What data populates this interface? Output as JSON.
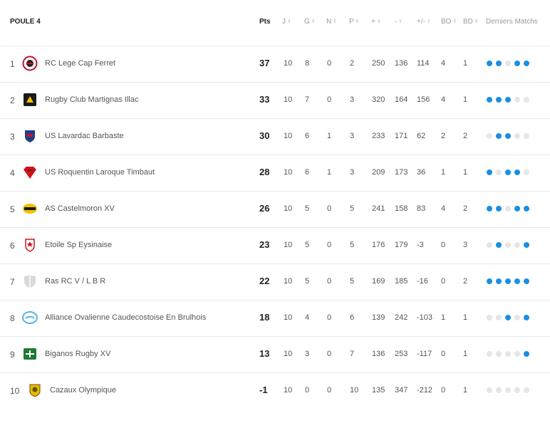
{
  "header": {
    "title": "POULE 4",
    "columns": {
      "pts": "Pts",
      "j": "J",
      "g": "G",
      "n": "N",
      "p": "P",
      "plus": "+",
      "minus": "-",
      "diff": "+/-",
      "bo": "BO",
      "bd": "BD",
      "last": "Derniers Matchs"
    }
  },
  "rows": [
    {
      "rank": "1",
      "team": "RC Lege Cap Ferret",
      "logo_icon": "lege-cap-ferret-logo-icon",
      "logo_color": "#c8102e",
      "pts": "37",
      "j": "10",
      "g": "8",
      "n": "0",
      "p": "2",
      "plus": "250",
      "minus": "136",
      "diff": "114",
      "bo": "4",
      "bd": "1",
      "form": [
        "W",
        "W",
        "L",
        "W",
        "W"
      ]
    },
    {
      "rank": "2",
      "team": "Rugby Club Martignas Illac",
      "logo_icon": "martignas-logo-icon",
      "logo_color": "#1a1a1a",
      "pts": "33",
      "j": "10",
      "g": "7",
      "n": "0",
      "p": "3",
      "plus": "320",
      "minus": "164",
      "diff": "156",
      "bo": "4",
      "bd": "1",
      "form": [
        "W",
        "W",
        "W",
        "L",
        "L"
      ]
    },
    {
      "rank": "3",
      "team": "US Lavardac Barbaste",
      "logo_icon": "lavardac-logo-icon",
      "logo_color": "#1d3f8a",
      "pts": "30",
      "j": "10",
      "g": "6",
      "n": "1",
      "p": "3",
      "plus": "233",
      "minus": "171",
      "diff": "62",
      "bo": "2",
      "bd": "2",
      "form": [
        "L",
        "W",
        "W",
        "L",
        "L"
      ]
    },
    {
      "rank": "4",
      "team": "US Roquentin Laroque Timbaut",
      "logo_icon": "roquentin-logo-icon",
      "logo_color": "#d0121b",
      "pts": "28",
      "j": "10",
      "g": "6",
      "n": "1",
      "p": "3",
      "plus": "209",
      "minus": "173",
      "diff": "36",
      "bo": "1",
      "bd": "1",
      "form": [
        "W",
        "L",
        "W",
        "W",
        "L"
      ]
    },
    {
      "rank": "5",
      "team": "AS Castelmoron XV",
      "logo_icon": "castelmoron-logo-icon",
      "logo_color": "#f2c200",
      "pts": "26",
      "j": "10",
      "g": "5",
      "n": "0",
      "p": "5",
      "plus": "241",
      "minus": "158",
      "diff": "83",
      "bo": "4",
      "bd": "2",
      "form": [
        "W",
        "W",
        "L",
        "W",
        "W"
      ]
    },
    {
      "rank": "6",
      "team": "Etoile Sp Eysinaise",
      "logo_icon": "eysinaise-logo-icon",
      "logo_color": "#d0121b",
      "pts": "23",
      "j": "10",
      "g": "5",
      "n": "0",
      "p": "5",
      "plus": "176",
      "minus": "179",
      "diff": "-3",
      "bo": "0",
      "bd": "3",
      "form": [
        "L",
        "W",
        "L",
        "L",
        "W"
      ]
    },
    {
      "rank": "7",
      "team": "Ras RC V / L B R",
      "logo_icon": "default-shield-icon",
      "logo_color": "#d9d9d9",
      "pts": "22",
      "j": "10",
      "g": "5",
      "n": "0",
      "p": "5",
      "plus": "169",
      "minus": "185",
      "diff": "-16",
      "bo": "0",
      "bd": "2",
      "form": [
        "W",
        "W",
        "W",
        "W",
        "W"
      ]
    },
    {
      "rank": "8",
      "team": "Alliance Ovalienne Caudecostoise En Brulhois",
      "logo_icon": "alliance-ovalienne-logo-icon",
      "logo_color": "#5bb3e6",
      "pts": "18",
      "j": "10",
      "g": "4",
      "n": "0",
      "p": "6",
      "plus": "139",
      "minus": "242",
      "diff": "-103",
      "bo": "1",
      "bd": "1",
      "form": [
        "L",
        "L",
        "W",
        "L",
        "W"
      ]
    },
    {
      "rank": "9",
      "team": "Biganos Rugby XV",
      "logo_icon": "biganos-logo-icon",
      "logo_color": "#1e7a34",
      "pts": "13",
      "j": "10",
      "g": "3",
      "n": "0",
      "p": "7",
      "plus": "136",
      "minus": "253",
      "diff": "-117",
      "bo": "0",
      "bd": "1",
      "form": [
        "L",
        "L",
        "L",
        "L",
        "W"
      ]
    },
    {
      "rank": "10",
      "team": "Cazaux Olympique",
      "logo_icon": "cazaux-logo-icon",
      "logo_color": "#e6b800",
      "pts": "-1",
      "j": "10",
      "g": "0",
      "n": "0",
      "p": "10",
      "plus": "135",
      "minus": "347",
      "diff": "-212",
      "bo": "0",
      "bd": "1",
      "form": [
        "L",
        "L",
        "L",
        "L",
        "L"
      ]
    }
  ]
}
